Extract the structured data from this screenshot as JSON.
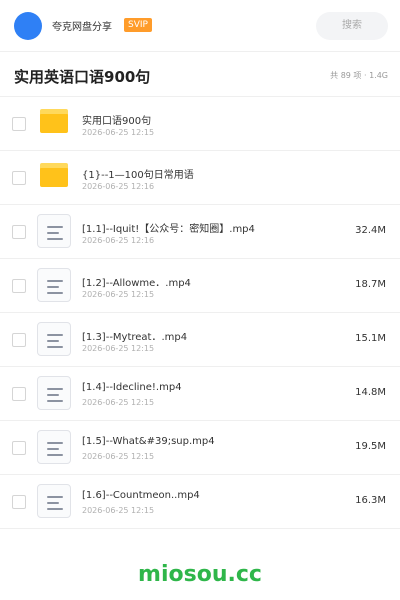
{
  "topbar": {
    "share_name": "夸克网盘分享",
    "badge": "SVIP",
    "search_placeholder": "搜索"
  },
  "header": {
    "title": "实用英语口语900句",
    "meta": "共 89 项 · 1.4G"
  },
  "items": [
    {
      "type": "folder",
      "icon": "folder-icon",
      "name": "实用口语900句",
      "date": "2026-06-25 12:15",
      "size": ""
    },
    {
      "type": "folder",
      "icon": "folder-icon",
      "name": "{1}--1—100句日常用语",
      "date": "2026-06-25 12:16",
      "size": ""
    },
    {
      "type": "file",
      "icon": "video-file-icon",
      "name": "[1.1]--Iquit!【公众号：密知圈】.mp4",
      "date": "2026-06-25 12:16",
      "size": "32.4M"
    },
    {
      "type": "file",
      "icon": "video-file-icon",
      "name": "[1.2]--Allowme．.mp4",
      "date": "2026-06-25 12:15",
      "size": "18.7M"
    },
    {
      "type": "file",
      "icon": "video-file-icon",
      "name": "[1.3]--Mytreat．.mp4",
      "date": "2026-06-25 12:15",
      "size": "15.1M"
    },
    {
      "type": "file",
      "icon": "video-file-icon",
      "name": "[1.4]--Idecline!.mp4",
      "date": "2026-06-25 12:15",
      "size": "14.8M"
    },
    {
      "type": "file",
      "icon": "video-file-icon",
      "name": "[1.5]--What&#39;sup.mp4",
      "date": "2026-06-25 12:15",
      "size": "19.5M"
    },
    {
      "type": "file",
      "icon": "video-file-icon",
      "name": "[1.6]--Countmeon..mp4",
      "date": "2026-06-25 12:15",
      "size": "16.3M"
    }
  ],
  "watermark": "miosou.cc",
  "colors": {
    "avatar": "#2f80f5",
    "svip_badge": "#ff9c2a",
    "folder": "#ffc21a",
    "watermark": "#2fb64a"
  }
}
